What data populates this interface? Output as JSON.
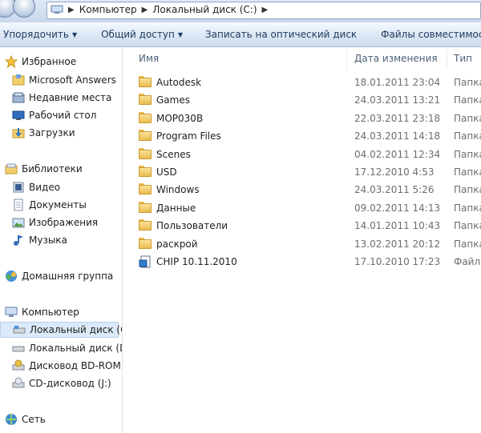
{
  "address": {
    "crumbs": [
      "Компьютер",
      "Локальный диск (C:)"
    ]
  },
  "toolbar": {
    "organize": "Упорядочить",
    "share": "Общий доступ",
    "burn": "Записать на оптический диск",
    "compat": "Файлы совместимости"
  },
  "sidebar": {
    "favorites": {
      "label": "Избранное",
      "items": [
        "Microsoft Answers",
        "Недавние места",
        "Рабочий стол",
        "Загрузки"
      ]
    },
    "libraries": {
      "label": "Библиотеки",
      "items": [
        "Видео",
        "Документы",
        "Изображения",
        "Музыка"
      ]
    },
    "homegroup": "Домашняя группа",
    "computer": {
      "label": "Компьютер",
      "items": [
        "Локальный диск (C:)",
        "Локальный диск (D:)",
        "Дисковод BD-ROM (",
        "CD-дисковод (J:)"
      ]
    },
    "network": "Сеть"
  },
  "columns": {
    "name": "Имя",
    "date": "Дата изменения",
    "type": "Тип"
  },
  "files": [
    {
      "name": "Autodesk",
      "date": "18.01.2011 23:04",
      "type": "Папка",
      "icon": "folder-icon"
    },
    {
      "name": "Games",
      "date": "24.03.2011 13:21",
      "type": "Папка",
      "icon": "folder-icon"
    },
    {
      "name": "MOP030B",
      "date": "22.03.2011 23:18",
      "type": "Папка",
      "icon": "folder-icon"
    },
    {
      "name": "Program Files",
      "date": "24.03.2011 14:18",
      "type": "Папка",
      "icon": "folder-icon"
    },
    {
      "name": "Scenes",
      "date": "04.02.2011 12:34",
      "type": "Папка",
      "icon": "folder-icon"
    },
    {
      "name": "USD",
      "date": "17.12.2010 4:53",
      "type": "Папка",
      "icon": "folder-icon"
    },
    {
      "name": "Windows",
      "date": "24.03.2011 5:26",
      "type": "Папка",
      "icon": "folder-icon"
    },
    {
      "name": "Данные",
      "date": "09.02.2011 14:13",
      "type": "Папка",
      "icon": "folder-icon"
    },
    {
      "name": "Пользователи",
      "date": "14.01.2011 10:43",
      "type": "Папка",
      "icon": "folder-icon"
    },
    {
      "name": "раскрой",
      "date": "13.02.2011 20:12",
      "type": "Папка",
      "icon": "folder-icon"
    },
    {
      "name": "CHIP 10.11.2010",
      "date": "17.10.2010 17:23",
      "type": "Файл",
      "icon": "file-icon"
    }
  ],
  "colors": {
    "selection": "#dce9f8",
    "toolbar_text": "#1e3a5f",
    "secondary_text": "#6d6d6d"
  }
}
